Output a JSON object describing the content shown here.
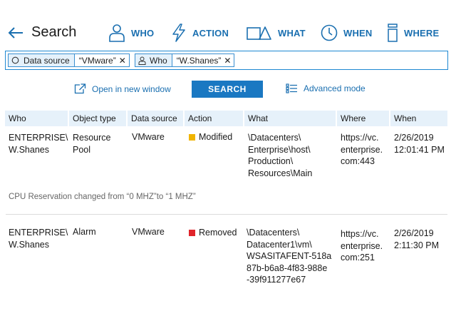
{
  "header": {
    "title": "Search",
    "nav": [
      {
        "label": "WHO",
        "icon": "person-icon"
      },
      {
        "label": "ACTION",
        "icon": "lightning-icon"
      },
      {
        "label": "WHAT",
        "icon": "shapes-icon"
      },
      {
        "label": "WHEN",
        "icon": "clock-icon"
      },
      {
        "label": "WHERE",
        "icon": "server-icon"
      }
    ]
  },
  "filters": [
    {
      "key": "Data source",
      "value": "“VMware”",
      "icon": "circle-icon"
    },
    {
      "key": "Who",
      "value": "“W.Shanes”",
      "icon": "person-icon"
    }
  ],
  "actions": {
    "open_new_window": "Open in new window",
    "search": "SEARCH",
    "advanced_mode": "Advanced mode"
  },
  "table": {
    "columns": [
      "Who",
      "Object type",
      "Data source",
      "Action",
      "What",
      "Where",
      "When"
    ],
    "rows": [
      {
        "who": "ENTERPRISE\\\nW.Shanes",
        "object_type": "Resource\nPool",
        "data_source": "VMware",
        "action": "Modified",
        "action_color": "#f0b400",
        "what": "\\Datacenters\\\nEnterprise\\host\\\nProduction\\\nResources\\Main",
        "where": "https://vc.\nenterprise.\ncom:443",
        "when": "2/26/2019\n12:01:41 PM",
        "note": "CPU Reservation changed from “0 MHZ”to “1 MHZ”"
      },
      {
        "who": "ENTERPRISE\\\nW.Shanes",
        "object_type": "Alarm",
        "data_source": "VMware",
        "action": "Removed",
        "action_color": "#e0242b",
        "what": "\\Datacenters\\\nDatacenter1\\vm\\\nWSASITAFENT-518a\n87b-b6a8-4f83-988e\n-39f911277e67",
        "where": "https://vc.\nenterprise.\ncom:251",
        "when": "2/26/2019\n2:11:30 PM"
      }
    ]
  }
}
